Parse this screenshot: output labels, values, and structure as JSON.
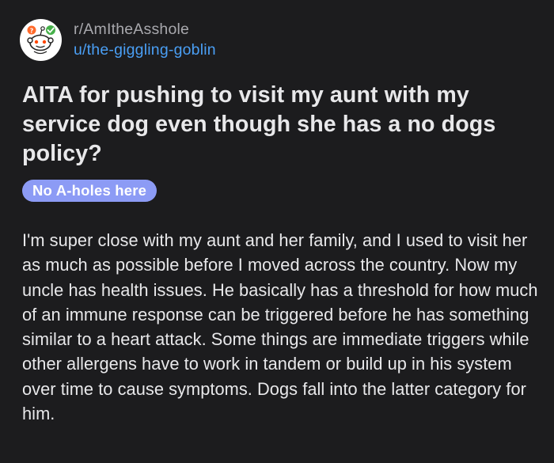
{
  "post": {
    "subreddit": "r/AmItheAsshole",
    "author": "u/the-giggling-goblin",
    "title": "AITA for pushing to visit my aunt with my service dog even though she has a no dogs policy?",
    "flair": {
      "label": "No A-holes here",
      "color": "#8c9bf5"
    },
    "body": "I'm super close with my aunt and her family, and I used to visit her as much as possible before I moved across the country. Now my uncle has health issues. He basically has a threshold for how much of an immune response can be triggered before he has something similar to a heart attack. Some things are immediate triggers while other allergens have to work in tandem or build up in his system over time to cause symptoms. Dogs fall into the latter category for him."
  },
  "avatar": {
    "icon": "reddit-snoo-judge-icon"
  },
  "colors": {
    "background": "#1c1c1e",
    "text": "#e8e8ea",
    "muted": "#a8a8ad",
    "link": "#4a9ff5"
  }
}
